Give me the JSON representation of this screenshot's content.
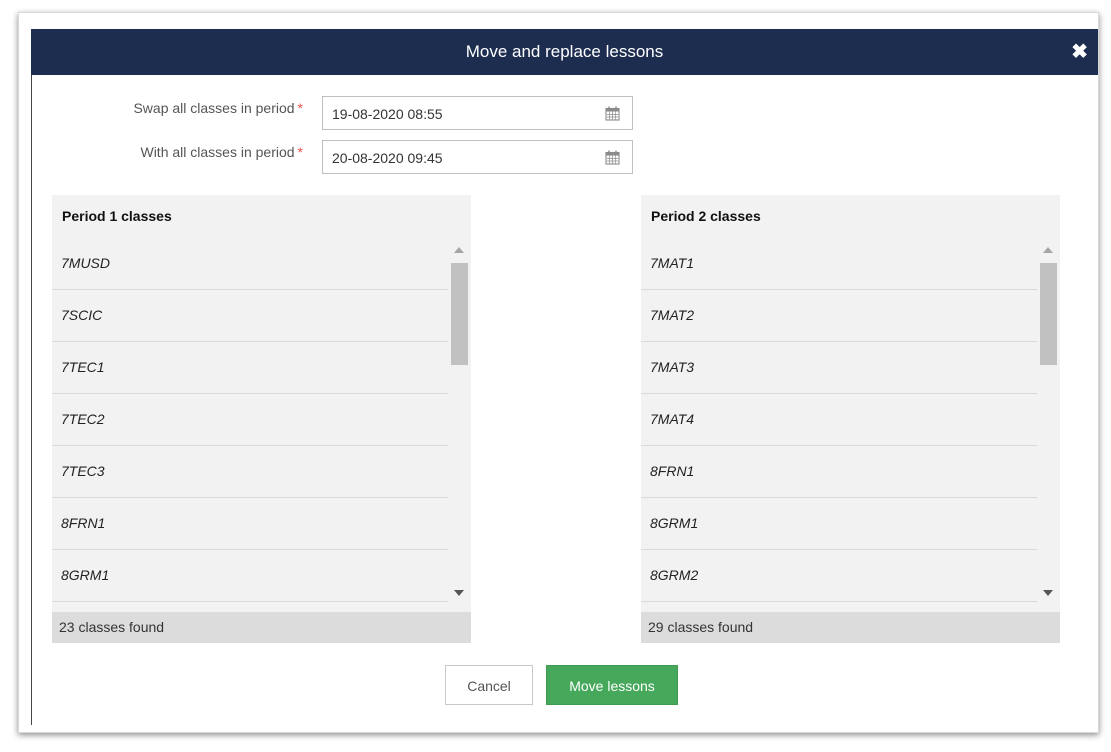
{
  "dialog": {
    "title": "Move and replace lessons",
    "close_icon": "close-icon"
  },
  "fields": {
    "swap": {
      "label": "Swap all classes in period",
      "required_mark": "*",
      "value": "19-08-2020 08:55",
      "icon": "calendar-icon"
    },
    "with": {
      "label": "With all classes in period",
      "required_mark": "*",
      "value": "20-08-2020 09:45",
      "icon": "calendar-icon"
    }
  },
  "period1": {
    "header": "Period 1 classes",
    "items": [
      "7MUSD",
      "7SCIC",
      "7TEC1",
      "7TEC2",
      "7TEC3",
      "8FRN1",
      "8GRM1"
    ],
    "footer": "23 classes found"
  },
  "period2": {
    "header": "Period 2 classes",
    "items": [
      "7MAT1",
      "7MAT2",
      "7MAT3",
      "7MAT4",
      "8FRN1",
      "8GRM1",
      "8GRM2"
    ],
    "footer": "29 classes found"
  },
  "buttons": {
    "cancel": "Cancel",
    "move": "Move lessons"
  },
  "colors": {
    "titlebar": "#1c2d50",
    "primary_button": "#46a85a",
    "required": "#e5534b"
  }
}
